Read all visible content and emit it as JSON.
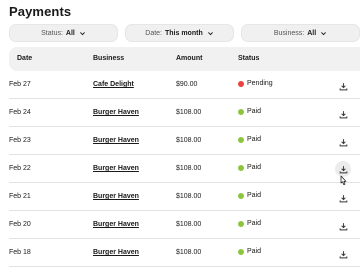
{
  "page": {
    "title": "Payments"
  },
  "filters": {
    "status": {
      "label": "Status:",
      "value": "All"
    },
    "date": {
      "label": "Date:",
      "value": "This month"
    },
    "business": {
      "label": "Business:",
      "value": "All"
    }
  },
  "table": {
    "headers": {
      "date": "Date",
      "business": "Business",
      "amount": "Amount",
      "status": "Status"
    },
    "rows": [
      {
        "date": "Feb 27",
        "business": "Cafe Delight",
        "amount": "$90.00",
        "status": "Pending",
        "status_color": "#e8433f"
      },
      {
        "date": "Feb 24",
        "business": "Burger Haven",
        "amount": "$108.00",
        "status": "Paid",
        "status_color": "#8cc63f"
      },
      {
        "date": "Feb 23",
        "business": "Burger Haven",
        "amount": "$108.00",
        "status": "Paid",
        "status_color": "#8cc63f"
      },
      {
        "date": "Feb 22",
        "business": "Burger Haven",
        "amount": "$108.00",
        "status": "Paid",
        "status_color": "#8cc63f"
      },
      {
        "date": "Feb 21",
        "business": "Burger Haven",
        "amount": "$108.00",
        "status": "Paid",
        "status_color": "#8cc63f"
      },
      {
        "date": "Feb 20",
        "business": "Burger Haven",
        "amount": "$108.00",
        "status": "Paid",
        "status_color": "#8cc63f"
      },
      {
        "date": "Feb 18",
        "business": "Burger Haven",
        "amount": "$108.00",
        "status": "Paid",
        "status_color": "#8cc63f"
      }
    ]
  },
  "icons": {
    "download": "download-icon",
    "chevron": "chevron-down-icon",
    "cursor": "mouse-pointer-icon"
  }
}
